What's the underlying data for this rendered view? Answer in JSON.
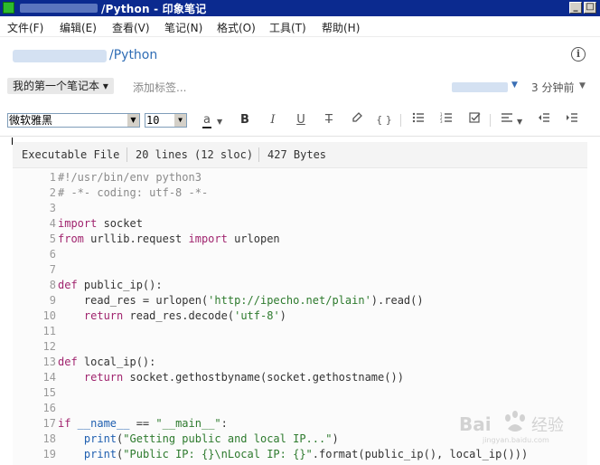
{
  "window": {
    "title": "/Python - 印象笔记"
  },
  "menu": [
    "文件(F)",
    "编辑(E)",
    "查看(V)",
    "笔记(N)",
    "格式(O)",
    "工具(T)",
    "帮助(H)"
  ],
  "path": {
    "notebook_path": "/Python"
  },
  "notebook_bar": {
    "notebook": "我的第一个笔记本 ▾",
    "tag_placeholder": "添加标签...",
    "updated": "3 分钟前"
  },
  "toolbar": {
    "font_family": "微软雅黑",
    "font_size": "10",
    "text_color_label": "a"
  },
  "code_info": {
    "type": "Executable File",
    "lines": "20 lines (12 sloc)",
    "size": "427 Bytes"
  },
  "code_lines": [
    {
      "num": "1",
      "segs": [
        {
          "t": "#!/usr/bin/env python3",
          "c": "#8a8a8a"
        }
      ]
    },
    {
      "num": "2",
      "segs": [
        {
          "t": "# -*- coding: utf-8 -*-",
          "c": "#8a8a8a"
        }
      ]
    },
    {
      "num": "3",
      "segs": []
    },
    {
      "num": "4",
      "segs": [
        {
          "t": "import",
          "c": "#a0246e"
        },
        {
          "t": " socket",
          "c": "#333333"
        }
      ]
    },
    {
      "num": "5",
      "segs": [
        {
          "t": "from",
          "c": "#a0246e"
        },
        {
          "t": " urllib.request ",
          "c": "#333333"
        },
        {
          "t": "import",
          "c": "#a0246e"
        },
        {
          "t": " urlopen",
          "c": "#333333"
        }
      ]
    },
    {
      "num": "6",
      "segs": []
    },
    {
      "num": "7",
      "segs": []
    },
    {
      "num": "8",
      "segs": [
        {
          "t": "def",
          "c": "#a0246e"
        },
        {
          "t": " public_ip():",
          "c": "#333333"
        }
      ]
    },
    {
      "num": "9",
      "segs": [
        {
          "t": "    read_res = urlopen(",
          "c": "#333333"
        },
        {
          "t": "'http://ipecho.net/plain'",
          "c": "#2d7a2d"
        },
        {
          "t": ").read()",
          "c": "#333333"
        }
      ]
    },
    {
      "num": "10",
      "segs": [
        {
          "t": "    ",
          "c": "#333333"
        },
        {
          "t": "return",
          "c": "#a0246e"
        },
        {
          "t": " read_res.decode(",
          "c": "#333333"
        },
        {
          "t": "'utf-8'",
          "c": "#2d7a2d"
        },
        {
          "t": ")",
          "c": "#333333"
        }
      ]
    },
    {
      "num": "11",
      "segs": []
    },
    {
      "num": "12",
      "segs": []
    },
    {
      "num": "13",
      "segs": [
        {
          "t": "def",
          "c": "#a0246e"
        },
        {
          "t": " local_ip():",
          "c": "#333333"
        }
      ]
    },
    {
      "num": "14",
      "segs": [
        {
          "t": "    ",
          "c": "#333333"
        },
        {
          "t": "return",
          "c": "#a0246e"
        },
        {
          "t": " socket.gethostbyname(socket.gethostname())",
          "c": "#333333"
        }
      ]
    },
    {
      "num": "15",
      "segs": []
    },
    {
      "num": "16",
      "segs": []
    },
    {
      "num": "17",
      "segs": [
        {
          "t": "if",
          "c": "#a0246e"
        },
        {
          "t": " __name__",
          "c": "#1f5fb0"
        },
        {
          "t": " == ",
          "c": "#333333"
        },
        {
          "t": "\"__main__\"",
          "c": "#2d7a2d"
        },
        {
          "t": ":",
          "c": "#333333"
        }
      ]
    },
    {
      "num": "18",
      "segs": [
        {
          "t": "    ",
          "c": "#333333"
        },
        {
          "t": "print",
          "c": "#1f5fb0"
        },
        {
          "t": "(",
          "c": "#333333"
        },
        {
          "t": "\"Getting public and local IP...\"",
          "c": "#2d7a2d"
        },
        {
          "t": ")",
          "c": "#333333"
        }
      ]
    },
    {
      "num": "19",
      "segs": [
        {
          "t": "    ",
          "c": "#333333"
        },
        {
          "t": "print",
          "c": "#1f5fb0"
        },
        {
          "t": "(",
          "c": "#333333"
        },
        {
          "t": "\"Public IP: {}\\nLocal IP: {}\"",
          "c": "#2d7a2d"
        },
        {
          "t": ".format(public_ip(), local_ip()))",
          "c": "#333333"
        }
      ]
    }
  ],
  "colors": {
    "title_bar": "#0b2a8f",
    "link": "#2f6db5",
    "keyword": "#a0246e",
    "string": "#2d7a2d",
    "builtin": "#1f5fb0",
    "comment": "#8a8a8a",
    "line_number": "#9a9a9a"
  },
  "watermark": {
    "text": "Bai经验",
    "subtext": "jingyan.baidu.com"
  }
}
